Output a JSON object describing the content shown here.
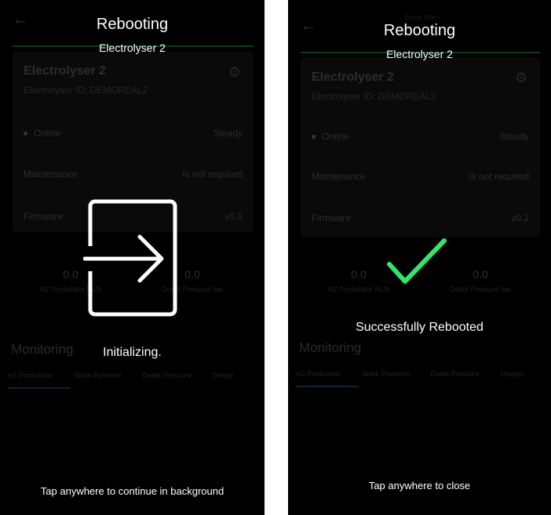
{
  "screens": [
    {
      "title": "Rebooting",
      "subtitle": "Electrolyser 2",
      "message": "Initializing.",
      "hint": "Tap anywhere to continue in background",
      "icon": "enter-icon",
      "background": {
        "device_name": "Electrolyser 2",
        "device_id": "Electrolyser ID: DEMOREAL2",
        "status": "Online",
        "state": "Steady",
        "maintenance_label": "Maintenance",
        "maintenance_value": "Is not required",
        "firmware_label": "Firmware",
        "firmware_value": "v0.1",
        "stat1_value": "0.0",
        "stat1_label": "H2 Production NL/h",
        "stat2_value": "0.0",
        "stat2_label": "Outlet Pressure bar",
        "monitoring": "Monitoring",
        "tabs": [
          "H2 Production",
          "Stack Pressure",
          "Outlet Pressure",
          "Tempe"
        ]
      }
    },
    {
      "title": "Rebooting",
      "subtitle": "Electrolyser 2",
      "message": "Successfully Rebooted",
      "hint": "Tap anywhere to close",
      "icon": "checkmark-icon",
      "accent": "#2ee86a",
      "background": {
        "top_label": "Some title",
        "device_name": "Electrolyser 2",
        "device_id": "Electrolyser ID: DEMOREAL2",
        "status": "Online",
        "state": "Steady",
        "maintenance_label": "Maintenance",
        "maintenance_value": "Is not required",
        "firmware_label": "Firmware",
        "firmware_value": "v0.1",
        "stat1_value": "0.0",
        "stat1_label": "H2 Production NL/h",
        "stat2_value": "0.0",
        "stat2_label": "Outlet Pressure bar",
        "monitoring": "Monitoring",
        "tabs": [
          "H2 Production",
          "Stack Pressure",
          "Outlet Pressure",
          "Oxygen"
        ]
      }
    }
  ]
}
